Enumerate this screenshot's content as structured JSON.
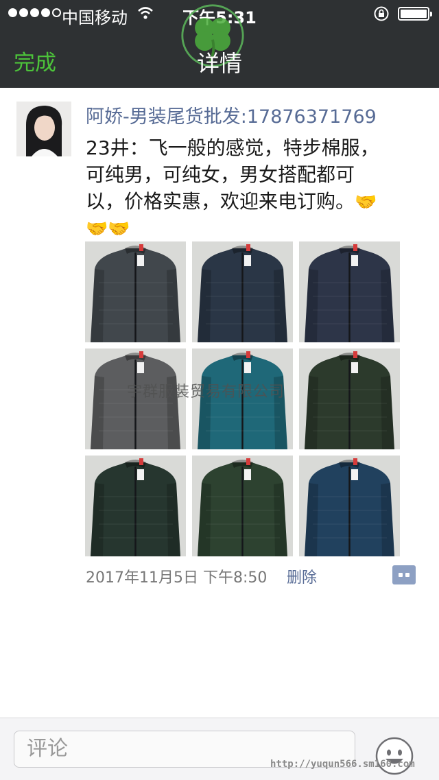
{
  "status_bar": {
    "carrier": "中国移动",
    "time": "下午5:31"
  },
  "nav": {
    "done_label": "完成",
    "title": "详情"
  },
  "post": {
    "author": "阿娇-男装尾货批发:17876371769",
    "text_line1": "23井：飞一般的感觉，特步棉服，",
    "text_line2": "可纯男，可纯女，男女搭配都可",
    "text_line3": "以，价格实惠，欢迎来电订购。",
    "handshake_emoji": "🤝",
    "timestamp": "2017年11月5日 下午8:50",
    "delete_label": "删除",
    "photos": [
      {
        "name": "jacket-dark-grey",
        "color": "#41474c"
      },
      {
        "name": "jacket-navy-green-sleeves",
        "color": "#2a3646"
      },
      {
        "name": "jacket-navy-white-grey-hood",
        "color": "#2d3548"
      },
      {
        "name": "jacket-grey-brown-hood",
        "color": "#5c5d5f"
      },
      {
        "name": "jacket-teal",
        "color": "#1f6878"
      },
      {
        "name": "jacket-green-camo",
        "color": "#2c3a2c"
      },
      {
        "name": "jacket-dark-green",
        "color": "#26362f"
      },
      {
        "name": "jacket-green-camo-hood",
        "color": "#2d4230"
      },
      {
        "name": "jacket-navy-blue",
        "color": "#21415e"
      }
    ]
  },
  "watermark": "宇群服装贸易有限公司",
  "comment_bar": {
    "placeholder": "评论"
  },
  "footer_url": "http://yuqun566.sm160.com",
  "colors": {
    "nav_background": "#2e3133",
    "accent_green": "#4cc33a",
    "link_blue": "#576b95"
  },
  "icons": [
    "wifi-icon",
    "rotation-lock-icon",
    "battery-icon",
    "clover-logo-icon",
    "comment-toggle-icon",
    "emoji-icon"
  ]
}
